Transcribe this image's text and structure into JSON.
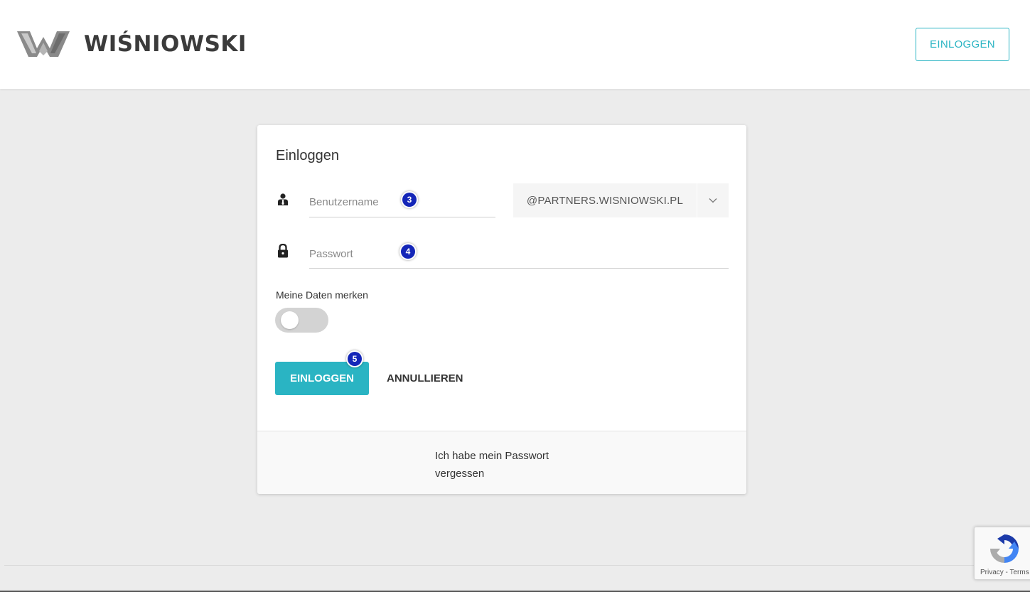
{
  "header": {
    "brand": "WIŚNIOWSKI",
    "login_button": "EINLOGGEN"
  },
  "login_card": {
    "title": "Einloggen",
    "username": {
      "placeholder": "Benutzername",
      "value": "",
      "marker": "3"
    },
    "domain": {
      "selected": "@PARTNERS.WISNIOWSKI.PL"
    },
    "password": {
      "placeholder": "Passwort",
      "value": "",
      "marker": "4"
    },
    "remember": {
      "label": "Meine Daten merken",
      "enabled": false
    },
    "submit": {
      "label": "EINLOGGEN",
      "marker": "5"
    },
    "cancel": {
      "label": "ANNULLIEREN"
    },
    "forgot_password": "Ich habe mein Passwort vergessen"
  },
  "recaptcha": {
    "links": "Privacy - Terms"
  },
  "colors": {
    "accent": "#2ab4c3",
    "background": "#ececec",
    "marker": "#1426b8"
  },
  "icons": {
    "brand_logo": "wisniowski-w-logo",
    "username": "user-icon",
    "password": "lock-icon",
    "dropdown": "chevron-down-icon",
    "recaptcha": "recaptcha-icon"
  }
}
